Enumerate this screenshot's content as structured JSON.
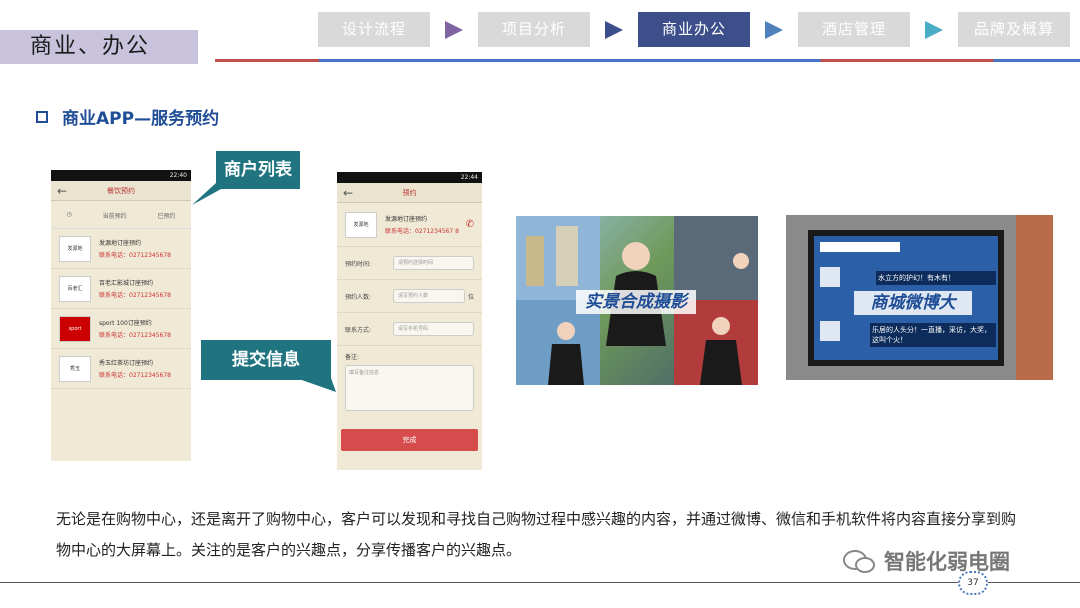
{
  "section_tag": "商业、办公",
  "nav": {
    "steps": [
      "设计流程",
      "项目分析",
      "商业办公",
      "酒店管理",
      "品牌及概算"
    ],
    "active_index": 2,
    "arrow_colors": [
      "#8064a2",
      "#3d4f8a",
      "#4f81bd",
      "#4bacc6"
    ]
  },
  "heading": "商业APP—服务预约",
  "callouts": {
    "merchant_list": "商户列表",
    "submit_info": "提交信息"
  },
  "phone_left": {
    "time": "22:40",
    "title": "餐饮预约",
    "filters": [
      "当前预约",
      "已预约"
    ],
    "merchants": [
      {
        "logo": "发源地",
        "name": "发源地订座预约",
        "phone": "联系电话：02712345678"
      },
      {
        "logo": "百老汇",
        "name": "百老汇影城订座预约",
        "phone": "联系电话：02712345678"
      },
      {
        "logo": "sport",
        "name": "sport 100订座预约",
        "phone": "联系电话：02712345678"
      },
      {
        "logo": "秀玉",
        "name": "秀玉红茶坊订座预约",
        "phone": "联系电话：02712345678"
      }
    ]
  },
  "phone_right": {
    "time": "22:44",
    "title": "预约",
    "shop_logo": "发源地",
    "shop_name": "发源地订座预约",
    "shop_phone": "联系电话：0271234567 8",
    "form": [
      {
        "label": "预约时间:",
        "placeholder": "请预约选择时间"
      },
      {
        "label": "预约人数:",
        "placeholder": "请写预约人数",
        "suffix": "位"
      },
      {
        "label": "联系方式:",
        "placeholder": "请写手机号码"
      }
    ],
    "note_label": "备注:",
    "note_placeholder": "填写备注信息",
    "submit": "完成"
  },
  "photos": {
    "composite_caption": "实景合成摄影",
    "screen_caption": "商城微博大",
    "screen_lines": [
      "水立方的护幻！有木有！",
      "乐居的人头分！一直播，采访，大奖，这叫个火！"
    ]
  },
  "body_text": "无论是在购物中心，还是离开了购物中心，客户可以发现和寻找自己购物过程中感兴趣的内容，并通过微博、微信和手机软件将内容直接分享到购物中心的大屏幕上。关注的是客户的兴趣点，分享传播客户的兴趣点。",
  "watermark": "智能化弱电圈",
  "page_number": "37"
}
